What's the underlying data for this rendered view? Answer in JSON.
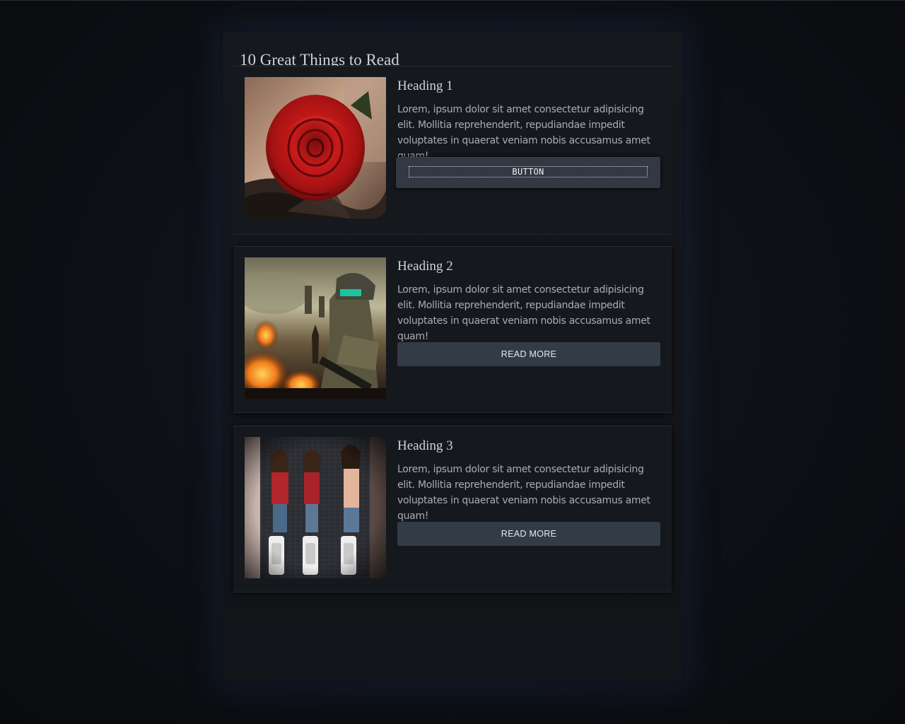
{
  "page": {
    "title": "10 Great Things to Read"
  },
  "cards": [
    {
      "heading": "Heading 1",
      "text": "Lorem, ipsum dolor sit amet consectetur adipisicing elit. Mollitia reprehenderit, repudiandae impedit voluptates in quaerat veniam nobis accusamus amet quam!",
      "button": "BUTTON",
      "image": "red-rose-photo"
    },
    {
      "heading": "Heading 2",
      "text": "Lorem, ipsum dolor sit amet consectetur adipisicing elit. Mollitia reprehenderit, repudiandae impedit voluptates in quaerat veniam nobis accusamus amet quam!",
      "button": "READ MORE",
      "image": "soldier-battlefield-photo"
    },
    {
      "heading": "Heading 3",
      "text": "Lorem, ipsum dolor sit amet consectetur adipisicing elit. Mollitia reprehenderit, repudiandae impedit voluptates in quaerat veniam nobis accusamus amet quam!",
      "button": "READ MORE",
      "image": "urinals-mural-photo"
    }
  ],
  "colors": {
    "background": "#0e1116",
    "panel": "#15181d",
    "button": "#333b47",
    "heading": "#cfd3d8",
    "text": "#a9aeb5"
  }
}
